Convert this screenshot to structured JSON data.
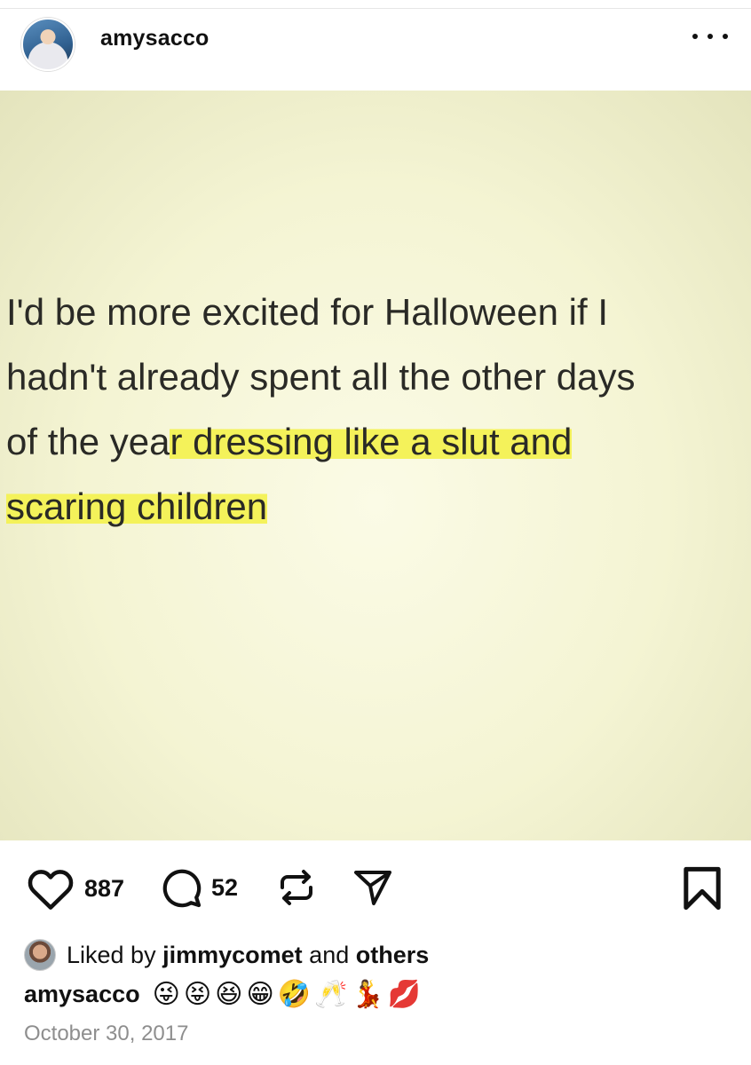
{
  "post": {
    "username": "amysacco",
    "quote": {
      "line1": "I'd be more excited for Halloween if I",
      "line2": "hadn't already spent all the other days",
      "line3_plain": "of the yea",
      "line3_highlight": "r dressing like a slut and",
      "line4_highlight": "scaring children"
    },
    "highlight_color": "#f4f25a"
  },
  "actions": {
    "likes": "887",
    "comments": "52",
    "icons": [
      "heart-icon",
      "comment-icon",
      "repost-icon",
      "share-icon",
      "bookmark-icon"
    ]
  },
  "liked_by": {
    "prefix": "Liked by",
    "user": "jimmycomet",
    "connector": "and",
    "suffix": "others"
  },
  "caption": {
    "username": "amysacco",
    "emojis": [
      "😜",
      "😝",
      "😆",
      "😁",
      "🤣",
      "🥂",
      "💃",
      "💋"
    ]
  },
  "date": "October 30, 2017"
}
